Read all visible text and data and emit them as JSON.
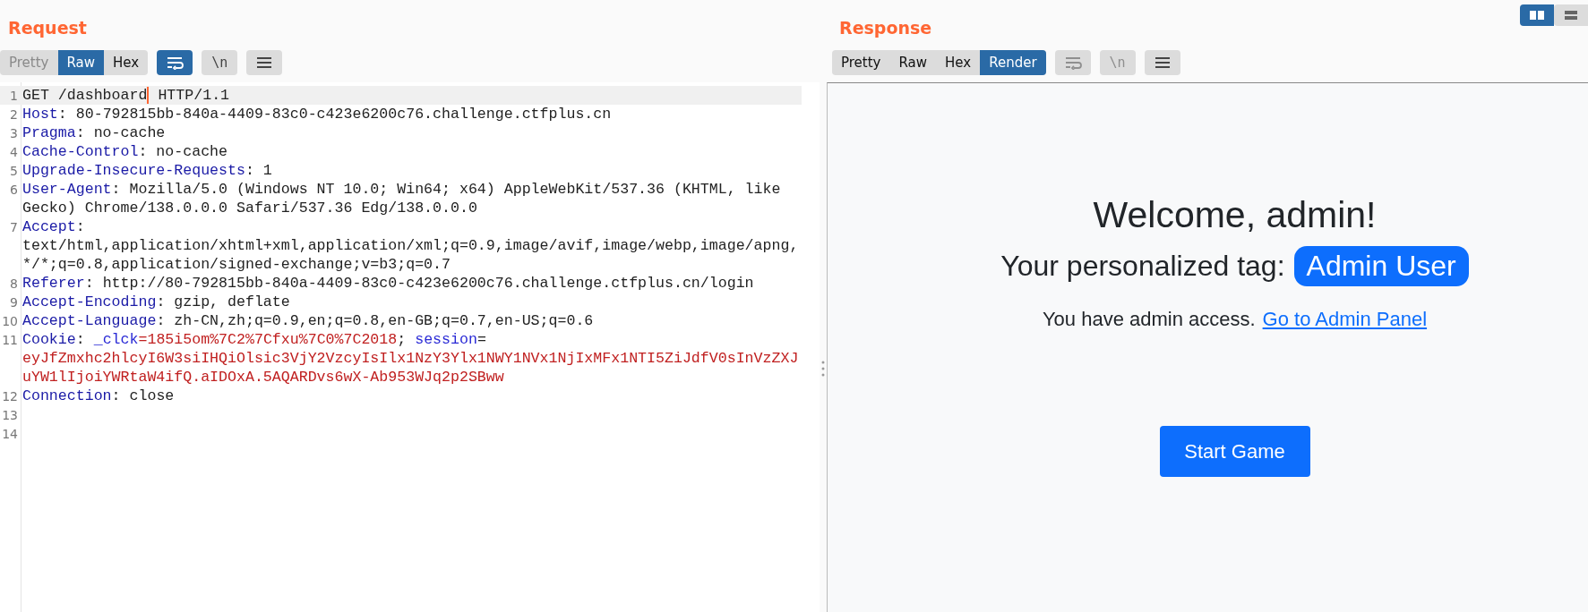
{
  "layout_toggle": [
    {
      "kind": "columns",
      "selected": true
    },
    {
      "kind": "rows",
      "selected": false
    }
  ],
  "request": {
    "title": "Request",
    "view_tabs": [
      {
        "label": "Pretty",
        "selected": false,
        "disabled": true
      },
      {
        "label": "Raw",
        "selected": true,
        "disabled": false
      },
      {
        "label": "Hex",
        "selected": false,
        "disabled": false
      }
    ],
    "tools": [
      {
        "kind": "wrap",
        "on": true,
        "disabled": false
      },
      {
        "kind": "newline",
        "label": "\\n",
        "on": false,
        "disabled": false
      },
      {
        "kind": "menu",
        "on": false,
        "disabled": false
      }
    ],
    "rows": [
      {
        "number": "1",
        "current": true,
        "segments": [
          {
            "kind": "plain",
            "text": "GET /dashboard"
          },
          {
            "kind": "cursor"
          },
          {
            "kind": "plain",
            "text": " HTTP/1.1"
          }
        ]
      },
      {
        "number": "2",
        "current": false,
        "segments": [
          {
            "kind": "name",
            "text": "Host"
          },
          {
            "kind": "plain",
            "text": ": 80-792815bb-840a-4409-83c0-c423e6200c76.challenge.ctfplus.cn"
          }
        ]
      },
      {
        "number": "3",
        "current": false,
        "segments": [
          {
            "kind": "name",
            "text": "Pragma"
          },
          {
            "kind": "plain",
            "text": ": no-cache"
          }
        ]
      },
      {
        "number": "4",
        "current": false,
        "segments": [
          {
            "kind": "name",
            "text": "Cache-Control"
          },
          {
            "kind": "plain",
            "text": ": no-cache"
          }
        ]
      },
      {
        "number": "5",
        "current": false,
        "segments": [
          {
            "kind": "name",
            "text": "Upgrade-Insecure-Requests"
          },
          {
            "kind": "plain",
            "text": ": 1"
          }
        ]
      },
      {
        "number": "6",
        "current": false,
        "segments": [
          {
            "kind": "name",
            "text": "User-Agent"
          },
          {
            "kind": "plain",
            "text": ": Mozilla/5.0 (Windows NT 10.0; Win64; x64) AppleWebKit/537.36 (KHTML, like"
          }
        ]
      },
      {
        "current": false,
        "segments": [
          {
            "kind": "plain",
            "text": "Gecko) Chrome/138.0.0.0 Safari/537.36 Edg/138.0.0.0"
          }
        ]
      },
      {
        "number": "7",
        "current": false,
        "segments": [
          {
            "kind": "name",
            "text": "Accept"
          },
          {
            "kind": "plain",
            "text": ":"
          }
        ]
      },
      {
        "current": false,
        "segments": [
          {
            "kind": "plain",
            "text": "text/html,application/xhtml+xml,application/xml;q=0.9,image/avif,image/webp,image/apng,"
          }
        ]
      },
      {
        "current": false,
        "segments": [
          {
            "kind": "plain",
            "text": "*/*;q=0.8,application/signed-exchange;v=b3;q=0.7"
          }
        ]
      },
      {
        "number": "8",
        "current": false,
        "segments": [
          {
            "kind": "name",
            "text": "Referer"
          },
          {
            "kind": "plain",
            "text": ": http://80-792815bb-840a-4409-83c0-c423e6200c76.challenge.ctfplus.cn/login"
          }
        ]
      },
      {
        "number": "9",
        "current": false,
        "segments": [
          {
            "kind": "name",
            "text": "Accept-Encoding"
          },
          {
            "kind": "plain",
            "text": ": gzip, deflate"
          }
        ]
      },
      {
        "number": "10",
        "current": false,
        "segments": [
          {
            "kind": "name",
            "text": "Accept-Language"
          },
          {
            "kind": "plain",
            "text": ": zh-CN,zh;q=0.9,en;q=0.8,en-GB;q=0.7,en-US;q=0.6"
          }
        ]
      },
      {
        "number": "11",
        "current": false,
        "segments": [
          {
            "kind": "name",
            "text": "Cookie"
          },
          {
            "kind": "plain",
            "text": ": "
          },
          {
            "kind": "cookie_name",
            "text": "_clck"
          },
          {
            "kind": "cookie_value",
            "text": "=185i5om%7C2%7Cfxu%7C0%7C2018"
          },
          {
            "kind": "plain",
            "text": "; "
          },
          {
            "kind": "cookie_name",
            "text": "session"
          },
          {
            "kind": "plain",
            "text": "="
          }
        ]
      },
      {
        "current": false,
        "segments": [
          {
            "kind": "cookie_value",
            "text": "eyJfZmxhc2hlcyI6W3siIHQiOlsic3VjY2VzcyIsIlx1NzY3Ylx1NWY1NVx1NjIxMFx1NTI5ZiJdfV0sInVzZXJ"
          }
        ]
      },
      {
        "current": false,
        "segments": [
          {
            "kind": "cookie_value",
            "text": "uYW1lIjoiYWRtaW4ifQ.aIDOxA.5AQARDvs6wX-Ab953WJq2p2SBww"
          }
        ]
      },
      {
        "number": "12",
        "current": false,
        "segments": [
          {
            "kind": "name",
            "text": "Connection"
          },
          {
            "kind": "plain",
            "text": ": close"
          }
        ]
      },
      {
        "number": "13",
        "current": false,
        "segments": []
      },
      {
        "number": "14",
        "current": false,
        "segments": []
      }
    ]
  },
  "response": {
    "title": "Response",
    "view_tabs": [
      {
        "label": "Pretty",
        "selected": false,
        "disabled": false
      },
      {
        "label": "Raw",
        "selected": false,
        "disabled": false
      },
      {
        "label": "Hex",
        "selected": false,
        "disabled": false
      },
      {
        "label": "Render",
        "selected": true,
        "disabled": false
      }
    ],
    "tools": [
      {
        "kind": "wrap",
        "on": false,
        "disabled": true
      },
      {
        "kind": "newline",
        "label": "\\n",
        "on": false,
        "disabled": true
      },
      {
        "kind": "menu",
        "on": false,
        "disabled": false
      }
    ],
    "render": {
      "heading": "Welcome, admin!",
      "tag_label": "Your personalized tag:",
      "tag": "Admin User",
      "access_text": "You have admin access.",
      "link": "Go to Admin Panel",
      "button": "Start Game"
    }
  }
}
